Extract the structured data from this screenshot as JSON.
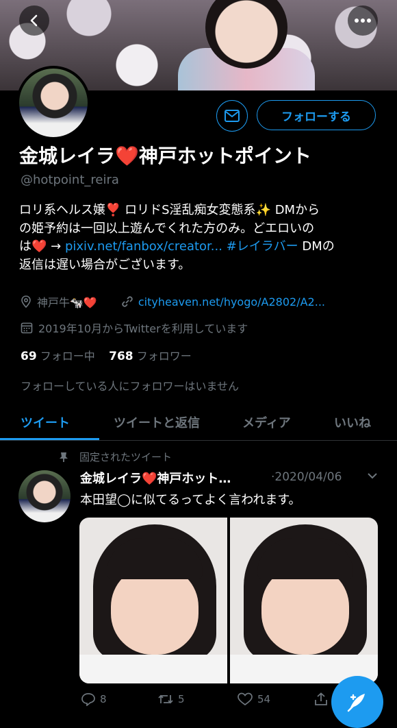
{
  "profile": {
    "name": "金城レイラ❤️神戸ホットポイント",
    "handle": "@hotpoint_reira",
    "follow_label": "フォローする",
    "bio_line1": "ロリ系ヘルス嬢❣️ ロリドS淫乱痴女変態系✨ DMから",
    "bio_line2": "の姫予約は一回以上遊んでくれた方のみ。どエロいの",
    "bio_line3_prefix": "は❤️ → ",
    "bio_link": "pixiv.net/fanbox/creator...",
    "bio_hashtag": "#レイラバー",
    "bio_line3_suffix": " DMの",
    "bio_line4": "返信は遅い場合がございます。",
    "location": "神戸牛🐄❤️",
    "website": "cityheaven.net/hyogo/A2802/A2...",
    "joined": "2019年10月からTwitterを利用しています",
    "following_count": "69",
    "following_label": "フォロー中",
    "followers_count": "768",
    "followers_label": "フォロワー",
    "no_mutuals": "フォローしている人にフォロワーはいません"
  },
  "tabs": [
    "ツイート",
    "ツイートと返信",
    "メディア",
    "いいね"
  ],
  "tweet": {
    "pinned_label": "固定されたツイート",
    "author": "金城レイラ❤️神戸ホット…",
    "date": "·2020/04/06",
    "text": "本田望◯に似てるってよく言われます。",
    "replies": "8",
    "retweets": "5",
    "likes": "54"
  },
  "colors": {
    "accent": "#1d9bf0",
    "muted": "#6e767d",
    "background": "#000000"
  }
}
